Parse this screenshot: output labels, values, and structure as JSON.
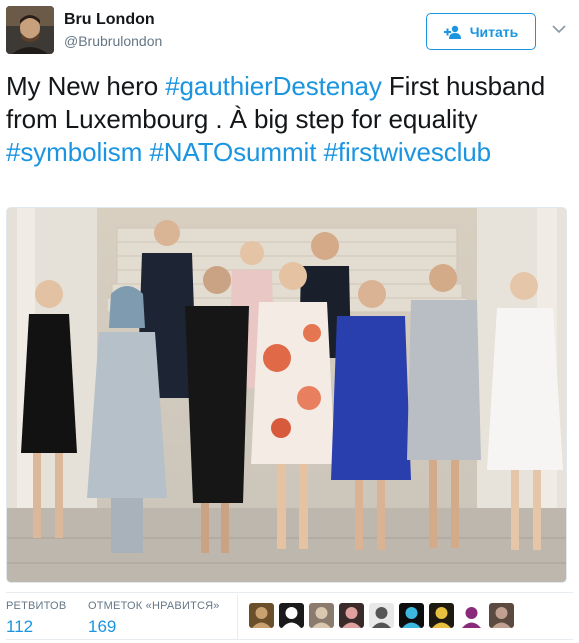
{
  "user": {
    "display_name": "Bru London",
    "handle": "@Brubrulondon",
    "avatar_icon": "user-avatar"
  },
  "follow_button": {
    "label": "Читать",
    "icon": "follow-user-icon"
  },
  "menu_icon": "chevron-down-icon",
  "tweet": {
    "segments": [
      {
        "text": "My New hero ",
        "type": "text"
      },
      {
        "text": "#gauthierDestenay",
        "type": "hashtag"
      },
      {
        "text": " First husband from Luxembourg . À big step for equality ",
        "type": "text"
      },
      {
        "text": "#symbolism",
        "type": "hashtag"
      },
      {
        "text": " ",
        "type": "text"
      },
      {
        "text": "#NATOsummit",
        "type": "hashtag"
      },
      {
        "text": " ",
        "type": "text"
      },
      {
        "text": "#firstwivesclub",
        "type": "hashtag"
      }
    ]
  },
  "stats": {
    "retweets_label": "РЕТВИТОВ",
    "retweets_value": "112",
    "likes_label": "ОТМЕТОК «НРАВИТСЯ»",
    "likes_value": "169"
  },
  "likers_count": 9,
  "colors": {
    "accent": "#1b95e0",
    "text": "#14171a",
    "secondary": "#657786",
    "border": "#e6ecf0"
  }
}
